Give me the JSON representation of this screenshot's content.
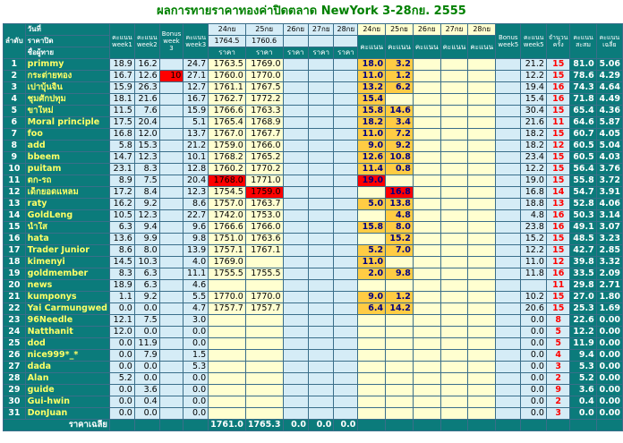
{
  "title": "ผลการทายราคาทองค่าปิดตลาด NewYork 3-28กย. 2555",
  "header": {
    "rank_label": "ลำดับ",
    "day_label": "วันที่",
    "close_label": "ราคาปิด",
    "name_label": "ชื่อผู้ทาย",
    "week1": "คะแนน week1",
    "week2": "คะแนน week2",
    "bonus3": "Bonus week 3",
    "week3": "คะแนน week3",
    "dates": [
      "24กย",
      "25กย",
      "26กย",
      "27กย",
      "28กย"
    ],
    "close_prices": [
      "1764.5",
      "1760.6",
      "",
      "",
      ""
    ],
    "price_label": "ราคา",
    "score_label": "คะแนน",
    "bonus5": "Bonus week5",
    "week5": "คะแนน week5",
    "count": "จำนวน ครั้ง",
    "total": "คะแนน สะสม",
    "avg": "คะแนน เฉลี่ย"
  },
  "rows": [
    {
      "r": "1",
      "n": "primmy",
      "w1": "18.9",
      "w2": "16.2",
      "b": "",
      "w3": "24.7",
      "p1": "1763.5",
      "p2": "1769.0",
      "s1": "18.0",
      "s2": "3.2",
      "w5": "21.2",
      "c": "15",
      "t": "81.0",
      "a": "5.06"
    },
    {
      "r": "2",
      "n": "กระต่ายทอง",
      "w1": "16.7",
      "w2": "12.6",
      "b": "10",
      "w3": "27.1",
      "p1": "1760.0",
      "p2": "1770.0",
      "s1": "11.0",
      "s2": "1.2",
      "w5": "12.2",
      "c": "15",
      "t": "78.6",
      "a": "4.29"
    },
    {
      "r": "3",
      "n": "เปาบุ้นจิ้น",
      "w1": "15.9",
      "w2": "26.3",
      "b": "",
      "w3": "12.7",
      "p1": "1761.1",
      "p2": "1767.5",
      "s1": "13.2",
      "s2": "6.2",
      "w5": "19.4",
      "c": "16",
      "t": "74.3",
      "a": "4.64"
    },
    {
      "r": "4",
      "n": "ชุมศักปทุม",
      "w1": "18.1",
      "w2": "21.6",
      "b": "",
      "w3": "16.7",
      "p1": "1762.7",
      "p2": "1772.2",
      "s1": "15.4",
      "s2": "",
      "w5": "15.4",
      "c": "16",
      "t": "71.8",
      "a": "4.49"
    },
    {
      "r": "5",
      "n": "ขาใหม่",
      "w1": "11.5",
      "w2": "7.6",
      "b": "",
      "w3": "15.9",
      "p1": "1766.6",
      "p2": "1763.3",
      "s1": "15.8",
      "s2": "14.6",
      "w5": "30.4",
      "c": "15",
      "t": "65.4",
      "a": "4.36"
    },
    {
      "r": "6",
      "n": "Moral principle",
      "w1": "17.5",
      "w2": "20.4",
      "b": "",
      "w3": "5.1",
      "p1": "1765.4",
      "p2": "1768.9",
      "s1": "18.2",
      "s2": "3.4",
      "w5": "21.6",
      "c": "11",
      "t": "64.6",
      "a": "5.87"
    },
    {
      "r": "7",
      "n": "foo",
      "w1": "16.8",
      "w2": "12.0",
      "b": "",
      "w3": "13.7",
      "p1": "1767.0",
      "p2": "1767.7",
      "s1": "11.0",
      "s2": "7.2",
      "w5": "18.2",
      "c": "15",
      "t": "60.7",
      "a": "4.05"
    },
    {
      "r": "8",
      "n": "add",
      "w1": "5.8",
      "w2": "15.3",
      "b": "",
      "w3": "21.2",
      "p1": "1759.0",
      "p2": "1766.0",
      "s1": "9.0",
      "s2": "9.2",
      "w5": "18.2",
      "c": "12",
      "t": "60.5",
      "a": "5.04"
    },
    {
      "r": "9",
      "n": "bbeem",
      "w1": "14.7",
      "w2": "12.3",
      "b": "",
      "w3": "10.1",
      "p1": "1768.2",
      "p2": "1765.2",
      "s1": "12.6",
      "s2": "10.8",
      "w5": "23.4",
      "c": "15",
      "t": "60.5",
      "a": "4.03"
    },
    {
      "r": "10",
      "n": "puitam",
      "w1": "23.1",
      "w2": "8.3",
      "b": "",
      "w3": "12.8",
      "p1": "1760.2",
      "p2": "1770.2",
      "s1": "11.4",
      "s2": "0.8",
      "w5": "12.2",
      "c": "15",
      "t": "56.4",
      "a": "3.76"
    },
    {
      "r": "11",
      "n": "ตก-รถ",
      "w1": "8.9",
      "w2": "7.5",
      "b": "",
      "w3": "20.4",
      "p1": "1768.0",
      "p2": "1771.0",
      "s1": "19.0",
      "s2": "",
      "w5": "19.0",
      "c": "15",
      "t": "55.8",
      "a": "3.72"
    },
    {
      "r": "12",
      "n": "เด็กยอดแหลม",
      "w1": "17.2",
      "w2": "8.4",
      "b": "",
      "w3": "12.3",
      "p1": "1754.5",
      "p2": "1759.0",
      "s1": "",
      "s2": "16.8",
      "w5": "16.8",
      "c": "14",
      "t": "54.7",
      "a": "3.91"
    },
    {
      "r": "13",
      "n": "raty",
      "w1": "16.2",
      "w2": "9.2",
      "b": "",
      "w3": "8.6",
      "p1": "1757.0",
      "p2": "1763.7",
      "s1": "5.0",
      "s2": "13.8",
      "w5": "18.8",
      "c": "13",
      "t": "52.8",
      "a": "4.06"
    },
    {
      "r": "14",
      "n": "GoldLeng",
      "w1": "10.5",
      "w2": "12.3",
      "b": "",
      "w3": "22.7",
      "p1": "1742.0",
      "p2": "1753.0",
      "s1": "",
      "s2": "4.8",
      "w5": "4.8",
      "c": "16",
      "t": "50.3",
      "a": "3.14"
    },
    {
      "r": "15",
      "n": "น้ำใส",
      "w1": "6.3",
      "w2": "9.4",
      "b": "",
      "w3": "9.6",
      "p1": "1766.6",
      "p2": "1766.0",
      "s1": "15.8",
      "s2": "8.0",
      "w5": "23.8",
      "c": "16",
      "t": "49.1",
      "a": "3.07"
    },
    {
      "r": "16",
      "n": "hata",
      "w1": "13.6",
      "w2": "9.9",
      "b": "",
      "w3": "9.8",
      "p1": "1751.0",
      "p2": "1763.6",
      "s1": "",
      "s2": "15.2",
      "w5": "15.2",
      "c": "15",
      "t": "48.5",
      "a": "3.23"
    },
    {
      "r": "17",
      "n": "Trader Junior",
      "w1": "8.6",
      "w2": "8.0",
      "b": "",
      "w3": "13.9",
      "p1": "1757.1",
      "p2": "1767.1",
      "s1": "5.2",
      "s2": "7.0",
      "w5": "12.2",
      "c": "15",
      "t": "42.7",
      "a": "2.85"
    },
    {
      "r": "18",
      "n": "kimenyi",
      "w1": "14.5",
      "w2": "10.3",
      "b": "",
      "w3": "4.0",
      "p1": "1769.0",
      "p2": "",
      "s1": "11.0",
      "s2": "",
      "w5": "11.0",
      "c": "12",
      "t": "39.8",
      "a": "3.32"
    },
    {
      "r": "19",
      "n": "goldmember",
      "w1": "8.3",
      "w2": "6.3",
      "b": "",
      "w3": "11.1",
      "p1": "1755.5",
      "p2": "1755.5",
      "s1": "2.0",
      "s2": "9.8",
      "w5": "11.8",
      "c": "16",
      "t": "33.5",
      "a": "2.09"
    },
    {
      "r": "20",
      "n": "news",
      "w1": "18.9",
      "w2": "6.3",
      "b": "",
      "w3": "4.6",
      "p1": "",
      "p2": "",
      "s1": "",
      "s2": "",
      "w5": "",
      "c": "11",
      "t": "29.8",
      "a": "2.71"
    },
    {
      "r": "21",
      "n": "kumponys",
      "w1": "1.1",
      "w2": "9.2",
      "b": "",
      "w3": "5.5",
      "p1": "1770.0",
      "p2": "1770.0",
      "s1": "9.0",
      "s2": "1.2",
      "w5": "10.2",
      "c": "15",
      "t": "27.0",
      "a": "1.80"
    },
    {
      "r": "22",
      "n": "Yai Carmungwed",
      "w1": "0.0",
      "w2": "0.0",
      "b": "",
      "w3": "4.7",
      "p1": "1757.7",
      "p2": "1757.7",
      "s1": "6.4",
      "s2": "14.2",
      "w5": "20.6",
      "c": "15",
      "t": "25.3",
      "a": "1.69"
    },
    {
      "r": "23",
      "n": "96Needle",
      "w1": "12.1",
      "w2": "7.5",
      "b": "",
      "w3": "3.0",
      "p1": "",
      "p2": "",
      "s1": "",
      "s2": "",
      "w5": "0.0",
      "c": "8",
      "t": "22.6",
      "a": "0.00"
    },
    {
      "r": "24",
      "n": "Natthanit",
      "w1": "12.0",
      "w2": "0.0",
      "b": "",
      "w3": "0.0",
      "p1": "",
      "p2": "",
      "s1": "",
      "s2": "",
      "w5": "0.0",
      "c": "5",
      "t": "12.2",
      "a": "0.00"
    },
    {
      "r": "25",
      "n": "dod",
      "w1": "0.0",
      "w2": "11.9",
      "b": "",
      "w3": "0.0",
      "p1": "",
      "p2": "",
      "s1": "",
      "s2": "",
      "w5": "0.0",
      "c": "5",
      "t": "11.9",
      "a": "0.00"
    },
    {
      "r": "26",
      "n": "nice999*_*",
      "w1": "0.0",
      "w2": "7.9",
      "b": "",
      "w3": "1.5",
      "p1": "",
      "p2": "",
      "s1": "",
      "s2": "",
      "w5": "0.0",
      "c": "4",
      "t": "9.4",
      "a": "0.00"
    },
    {
      "r": "27",
      "n": "dada",
      "w1": "0.0",
      "w2": "0.0",
      "b": "",
      "w3": "5.3",
      "p1": "",
      "p2": "",
      "s1": "",
      "s2": "",
      "w5": "0.0",
      "c": "3",
      "t": "5.3",
      "a": "0.00"
    },
    {
      "r": "28",
      "n": "Alan",
      "w1": "5.2",
      "w2": "0.0",
      "b": "",
      "w3": "0.0",
      "p1": "",
      "p2": "",
      "s1": "",
      "s2": "",
      "w5": "0.0",
      "c": "2",
      "t": "5.2",
      "a": "0.00"
    },
    {
      "r": "29",
      "n": "guide",
      "w1": "0.0",
      "w2": "3.6",
      "b": "",
      "w3": "0.0",
      "p1": "",
      "p2": "",
      "s1": "",
      "s2": "",
      "w5": "0.0",
      "c": "9",
      "t": "3.6",
      "a": "0.00"
    },
    {
      "r": "30",
      "n": "Gui-hwin",
      "w1": "0.0",
      "w2": "0.4",
      "b": "",
      "w3": "0.0",
      "p1": "",
      "p2": "",
      "s1": "",
      "s2": "",
      "w5": "0.0",
      "c": "2",
      "t": "0.4",
      "a": "0.00"
    },
    {
      "r": "31",
      "n": "DonJuan",
      "w1": "0.0",
      "w2": "0.0",
      "b": "",
      "w3": "0.0",
      "p1": "",
      "p2": "",
      "s1": "",
      "s2": "",
      "w5": "0.0",
      "c": "3",
      "t": "0.0",
      "a": "0.00"
    }
  ],
  "footer": {
    "label": "ราคาเฉลี่ย",
    "avg_prices": [
      "1761.0",
      "1765.3",
      "0.0",
      "0.0",
      "0.0"
    ]
  },
  "colors": {
    "teal": "#0b7b7b",
    "light_blue": "#d5ecf6",
    "light_yellow": "#ffffd0",
    "score_highlight": "#ffcc44",
    "alert_red": "#ff0000"
  }
}
